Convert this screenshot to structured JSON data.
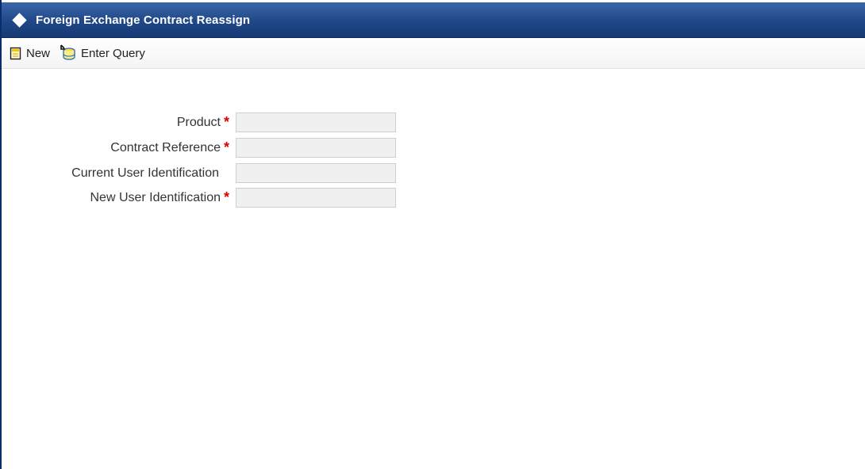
{
  "window": {
    "title": "Foreign Exchange Contract Reassign"
  },
  "toolbar": {
    "new_label": "New",
    "enter_query_label": "Enter Query"
  },
  "form": {
    "fields": [
      {
        "label": "Product",
        "required": true,
        "value": ""
      },
      {
        "label": "Contract Reference",
        "required": true,
        "value": ""
      },
      {
        "label": "Current User Identification",
        "required": false,
        "value": ""
      },
      {
        "label": "New User Identification",
        "required": true,
        "value": ""
      }
    ],
    "required_marker": "*"
  },
  "colors": {
    "titlebar": "#1e4585",
    "required": "#e00000",
    "field_bg": "#f0f0f0"
  },
  "icons": {
    "title": "diamond-icon",
    "new": "new-document-icon",
    "enter_query": "enter-query-icon"
  }
}
